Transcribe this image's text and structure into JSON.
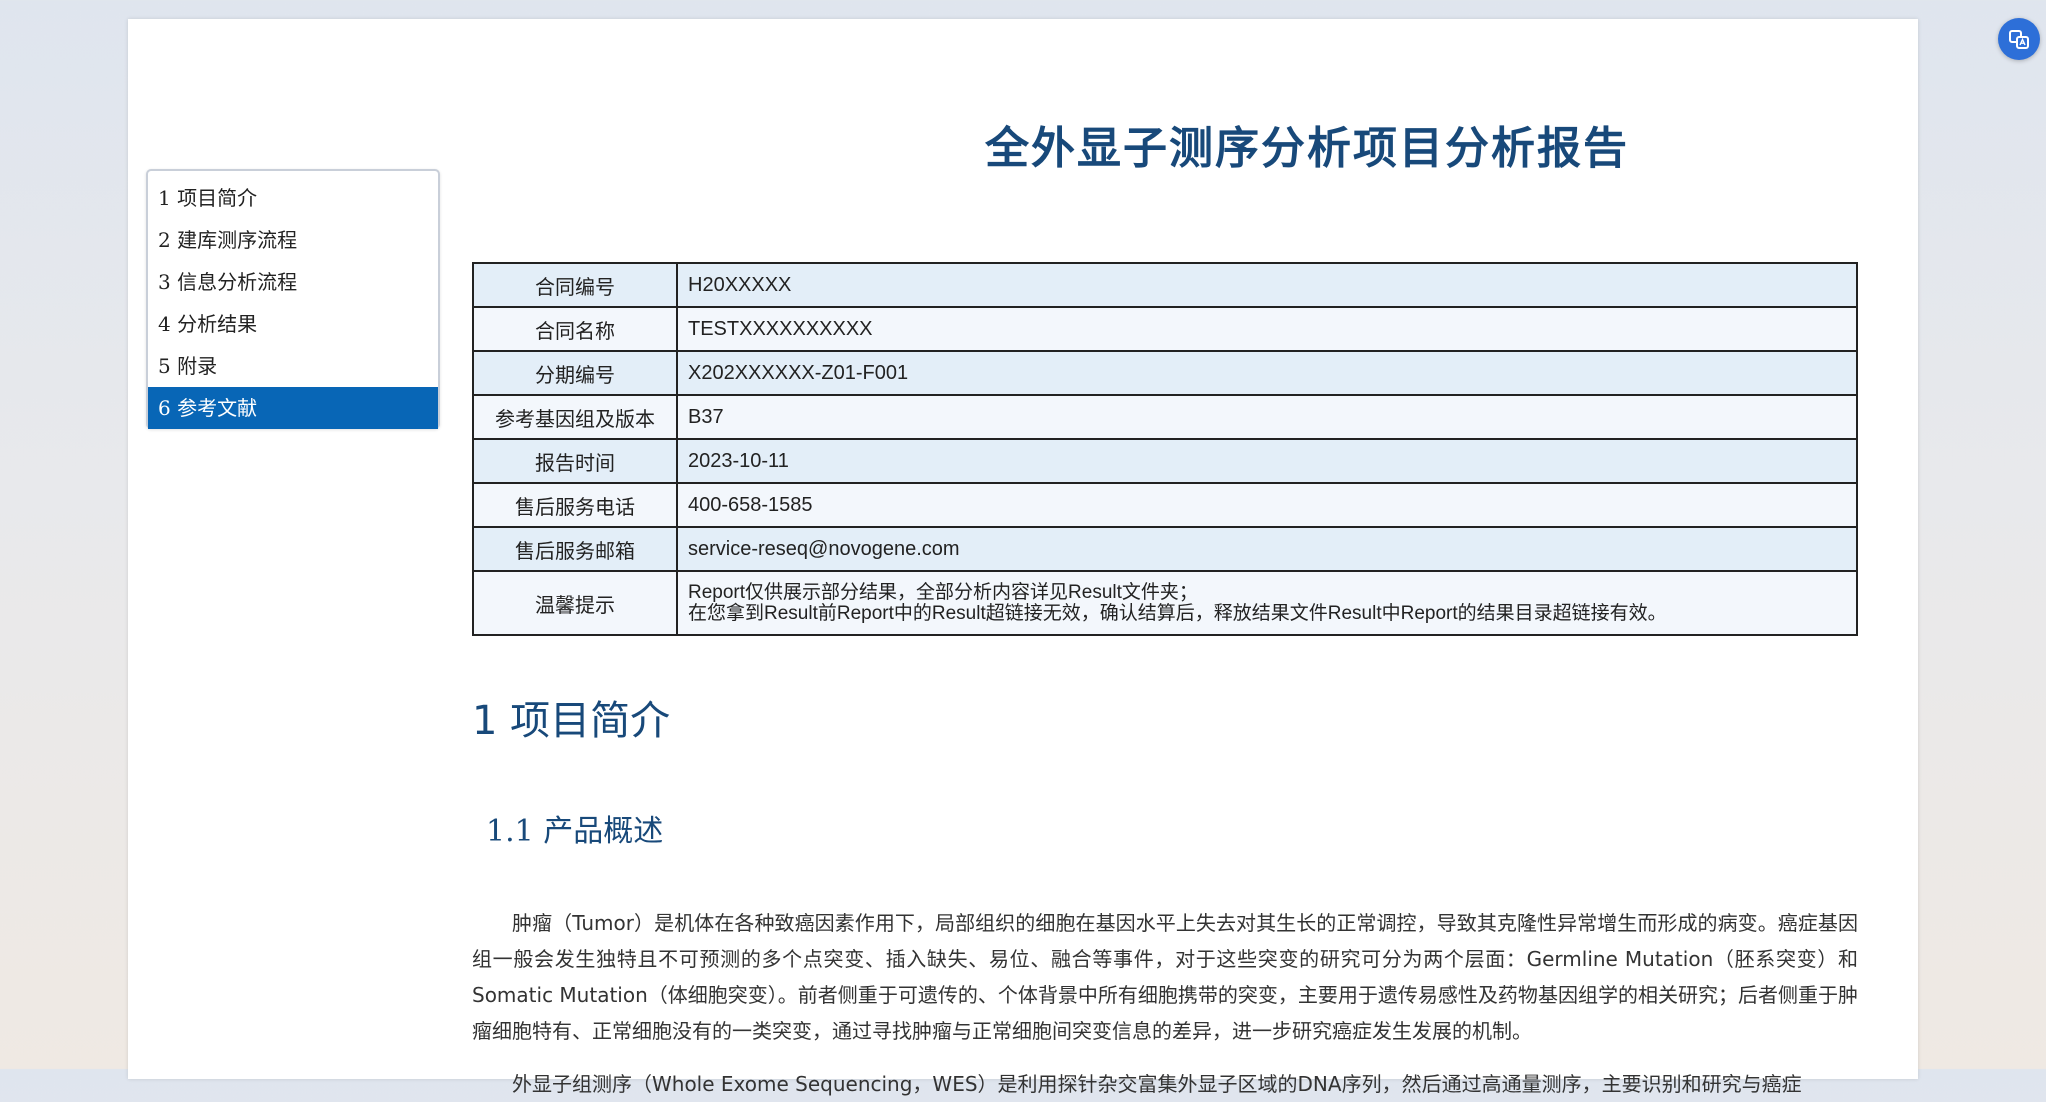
{
  "toc": {
    "items": [
      {
        "label": "1 项目简介"
      },
      {
        "label": "2 建库测序流程"
      },
      {
        "label": "3 信息分析流程"
      },
      {
        "label": "4 分析结果"
      },
      {
        "label": "5 附录"
      },
      {
        "label": "6 参考文献"
      }
    ],
    "active_index": 5
  },
  "report": {
    "title": "全外显子测序分析项目分析报告"
  },
  "info_table": {
    "rows": [
      {
        "key": "合同编号",
        "value": "H20XXXXX"
      },
      {
        "key": "合同名称",
        "value": "TESTXXXXXXXXXX"
      },
      {
        "key": "分期编号",
        "value": "X202XXXXXX-Z01-F001"
      },
      {
        "key": "参考基因组及版本",
        "value": "B37"
      },
      {
        "key": "报告时间",
        "value": "2023-10-11"
      },
      {
        "key": "售后服务电话",
        "value": "400-658-1585"
      },
      {
        "key": "售后服务邮箱",
        "value": "service-reseq@novogene.com"
      },
      {
        "key": "温馨提示",
        "value_line1": "Report仅供展示部分结果，全部分析内容详见Result文件夹；",
        "value_line2": "在您拿到Result前Report中的Result超链接无效，确认结算后，释放结果文件Result中Report的结果目录超链接有效。"
      }
    ]
  },
  "section1": {
    "heading": "1 项目简介",
    "sub_heading": "1.1 产品概述",
    "paragraph1": "肿瘤（Tumor）是机体在各种致癌因素作用下，局部组织的细胞在基因水平上失去对其生长的正常调控，导致其克隆性异常增生而形成的病变。癌症基因组一般会发生独特且不可预测的多个点突变、插入缺失、易位、融合等事件，对于这些突变的研究可分为两个层面：Germline Mutation（胚系突变）和Somatic Mutation（体细胞突变）。前者侧重于可遗传的、个体背景中所有细胞携带的突变，主要用于遗传易感性及药物基因组学的相关研究；后者侧重于肿瘤细胞特有、正常细胞没有的一类突变，通过寻找肿瘤与正常细胞间突变信息的差异，进一步研究癌症发生发展的机制。",
    "paragraph2": "外显子组测序（Whole Exome Sequencing，WES）是利用探针杂交富集外显子区域的DNA序列，然后通过高通量测序，主要识别和研究与癌症"
  },
  "colors": {
    "accent": "#0866b6",
    "title": "#18497a",
    "row_odd": "#e3eef8",
    "row_even": "#f3f7fc"
  },
  "icons": {
    "floating_button": "translate-icon"
  }
}
